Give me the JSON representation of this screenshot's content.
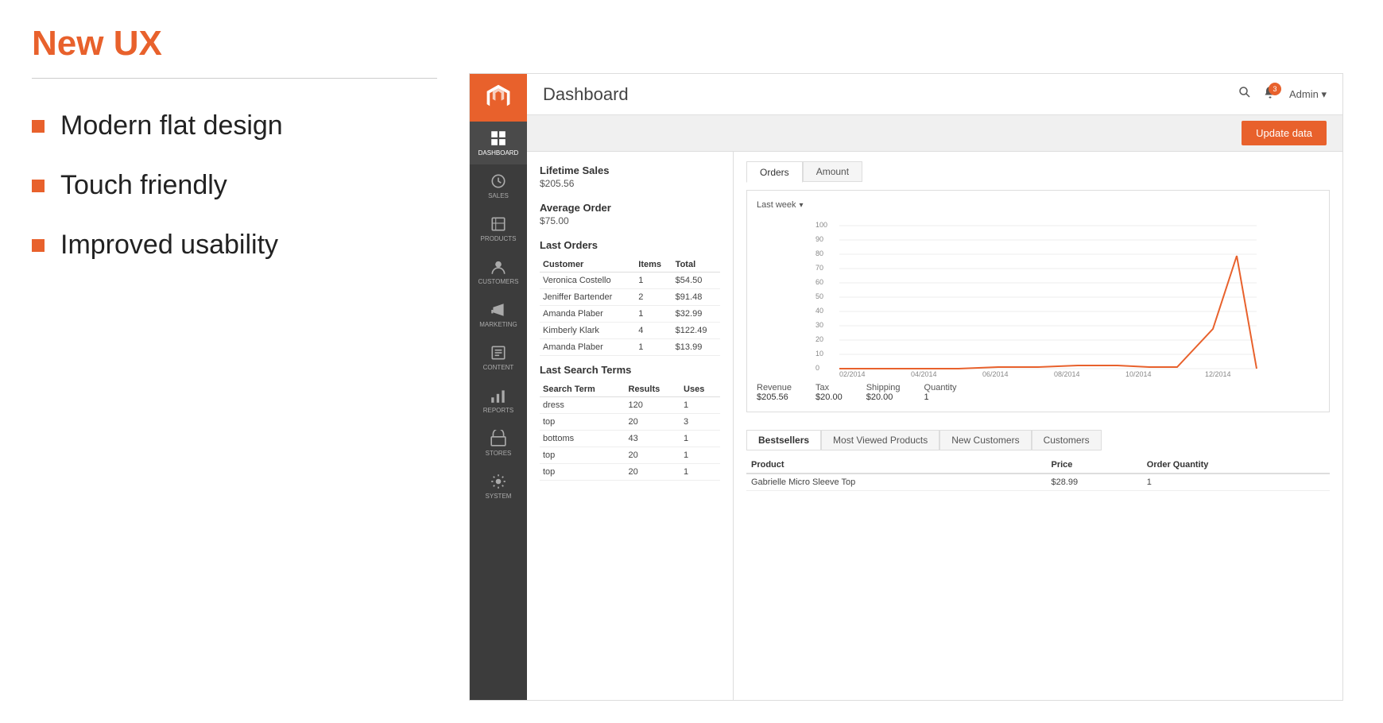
{
  "presentation": {
    "title": "New UX",
    "bullets": [
      "Modern flat design",
      "Touch friendly",
      "Improved usability"
    ]
  },
  "sidebar": {
    "items": [
      {
        "id": "dashboard",
        "label": "DASHBOARD",
        "active": true
      },
      {
        "id": "sales",
        "label": "SALES",
        "active": false
      },
      {
        "id": "products",
        "label": "PRODUCTS",
        "active": false
      },
      {
        "id": "customers",
        "label": "CUSTOMERS",
        "active": false
      },
      {
        "id": "marketing",
        "label": "MARKETING",
        "active": false
      },
      {
        "id": "content",
        "label": "CONTENT",
        "active": false
      },
      {
        "id": "reports",
        "label": "REPORTS",
        "active": false
      },
      {
        "id": "stores",
        "label": "STORES",
        "active": false
      },
      {
        "id": "system",
        "label": "SYSTEM",
        "active": false
      }
    ]
  },
  "header": {
    "title": "Dashboard",
    "notifications": "3",
    "admin_label": "Admin ▾",
    "update_btn": "Update data"
  },
  "stats": {
    "lifetime_sales_label": "Lifetime Sales",
    "lifetime_sales_value": "$205.56",
    "average_order_label": "Average Order",
    "average_order_value": "$75.00"
  },
  "last_orders": {
    "title": "Last Orders",
    "columns": [
      "Customer",
      "Items",
      "Total"
    ],
    "rows": [
      {
        "customer": "Veronica Costello",
        "items": "1",
        "total": "$54.50"
      },
      {
        "customer": "Jeniffer Bartender",
        "items": "2",
        "total": "$91.48"
      },
      {
        "customer": "Amanda Plaber",
        "items": "1",
        "total": "$32.99"
      },
      {
        "customer": "Kimberly Klark",
        "items": "4",
        "total": "$122.49"
      },
      {
        "customer": "Amanda Plaber",
        "items": "1",
        "total": "$13.99"
      }
    ]
  },
  "last_search_terms": {
    "title": "Last Search Terms",
    "columns": [
      "Search Term",
      "Results",
      "Uses"
    ],
    "rows": [
      {
        "term": "dress",
        "results": "120",
        "uses": "1"
      },
      {
        "term": "top",
        "results": "20",
        "uses": "3"
      },
      {
        "term": "bottoms",
        "results": "43",
        "uses": "1"
      },
      {
        "term": "top",
        "results": "20",
        "uses": "1"
      },
      {
        "term": "top",
        "results": "20",
        "uses": "1"
      }
    ]
  },
  "chart": {
    "tabs": [
      "Orders",
      "Amount"
    ],
    "active_tab": "Orders",
    "period_label": "Last week",
    "y_labels": [
      "100",
      "90",
      "80",
      "70",
      "60",
      "50",
      "40",
      "30",
      "20",
      "10",
      "0"
    ],
    "x_labels": [
      "02/2014",
      "04/2014",
      "06/2014",
      "08/2014",
      "10/2014",
      "12/2014"
    ],
    "stats": [
      {
        "label": "Revenue",
        "value": "$205.56"
      },
      {
        "label": "Tax",
        "value": "$20.00"
      },
      {
        "label": "Shipping",
        "value": "$20.00"
      },
      {
        "label": "Quantity",
        "value": "1"
      }
    ]
  },
  "bottom_tabs": {
    "tabs": [
      "Bestsellers",
      "Most Viewed Products",
      "New Customers",
      "Customers"
    ],
    "active_tab": "Bestsellers"
  },
  "products_table": {
    "columns": [
      "Product",
      "Price",
      "Order Quantity"
    ],
    "rows": [
      {
        "product": "Gabrielle Micro Sleeve Top",
        "price": "$28.99",
        "qty": "1"
      }
    ]
  }
}
